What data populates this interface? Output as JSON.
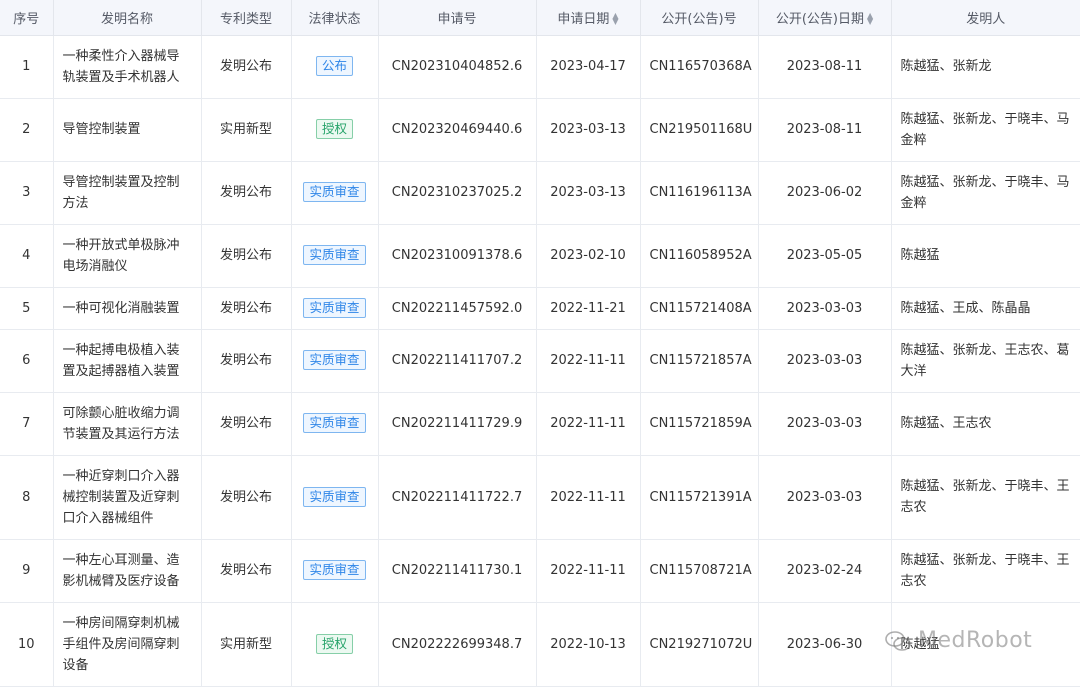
{
  "columns": {
    "index": "序号",
    "name": "发明名称",
    "type": "专利类型",
    "legal": "法律状态",
    "app_no": "申请号",
    "app_date": "申请日期",
    "pub_no": "公开(公告)号",
    "pub_date": "公开(公告)日期",
    "inventors": "发明人"
  },
  "status_colors": {
    "公布": "#2f86e8",
    "授权": "#27a36a",
    "实质审查": "#2f86e8"
  },
  "rows": [
    {
      "index": "1",
      "name": "一种柔性介入器械导轨装置及手术机器人",
      "type": "发明公布",
      "legal": "公布",
      "app_no": "CN202310404852.6",
      "app_date": "2023-04-17",
      "pub_no": "CN116570368A",
      "pub_date": "2023-08-11",
      "inventors": "陈越猛、张新龙"
    },
    {
      "index": "2",
      "name": "导管控制装置",
      "type": "实用新型",
      "legal": "授权",
      "app_no": "CN202320469440.6",
      "app_date": "2023-03-13",
      "pub_no": "CN219501168U",
      "pub_date": "2023-08-11",
      "inventors": "陈越猛、张新龙、于晓丰、马金粹"
    },
    {
      "index": "3",
      "name": "导管控制装置及控制方法",
      "type": "发明公布",
      "legal": "实质审查",
      "app_no": "CN202310237025.2",
      "app_date": "2023-03-13",
      "pub_no": "CN116196113A",
      "pub_date": "2023-06-02",
      "inventors": "陈越猛、张新龙、于晓丰、马金粹"
    },
    {
      "index": "4",
      "name": "一种开放式单极脉冲电场消融仪",
      "type": "发明公布",
      "legal": "实质审查",
      "app_no": "CN202310091378.6",
      "app_date": "2023-02-10",
      "pub_no": "CN116058952A",
      "pub_date": "2023-05-05",
      "inventors": "陈越猛"
    },
    {
      "index": "5",
      "name": "一种可视化消融装置",
      "type": "发明公布",
      "legal": "实质审查",
      "app_no": "CN202211457592.0",
      "app_date": "2022-11-21",
      "pub_no": "CN115721408A",
      "pub_date": "2023-03-03",
      "inventors": "陈越猛、王成、陈晶晶"
    },
    {
      "index": "6",
      "name": "一种起搏电极植入装置及起搏器植入装置",
      "type": "发明公布",
      "legal": "实质审查",
      "app_no": "CN202211411707.2",
      "app_date": "2022-11-11",
      "pub_no": "CN115721857A",
      "pub_date": "2023-03-03",
      "inventors": "陈越猛、张新龙、王志农、葛大洋"
    },
    {
      "index": "7",
      "name": "可除颤心脏收缩力调节装置及其运行方法",
      "type": "发明公布",
      "legal": "实质审查",
      "app_no": "CN202211411729.9",
      "app_date": "2022-11-11",
      "pub_no": "CN115721859A",
      "pub_date": "2023-03-03",
      "inventors": "陈越猛、王志农"
    },
    {
      "index": "8",
      "name": "一种近穿刺口介入器械控制装置及近穿刺口介入器械组件",
      "type": "发明公布",
      "legal": "实质审查",
      "app_no": "CN202211411722.7",
      "app_date": "2022-11-11",
      "pub_no": "CN115721391A",
      "pub_date": "2023-03-03",
      "inventors": "陈越猛、张新龙、于晓丰、王志农"
    },
    {
      "index": "9",
      "name": "一种左心耳测量、造影机械臂及医疗设备",
      "type": "发明公布",
      "legal": "实质审查",
      "app_no": "CN202211411730.1",
      "app_date": "2022-11-11",
      "pub_no": "CN115708721A",
      "pub_date": "2023-02-24",
      "inventors": "陈越猛、张新龙、于晓丰、王志农"
    },
    {
      "index": "10",
      "name": "一种房间隔穿刺机械手组件及房间隔穿刺设备",
      "type": "实用新型",
      "legal": "授权",
      "app_no": "CN202222699348.7",
      "app_date": "2022-10-13",
      "pub_no": "CN219271072U",
      "pub_date": "2023-06-30",
      "inventors": "陈越猛"
    }
  ],
  "watermark": "MedRobot"
}
